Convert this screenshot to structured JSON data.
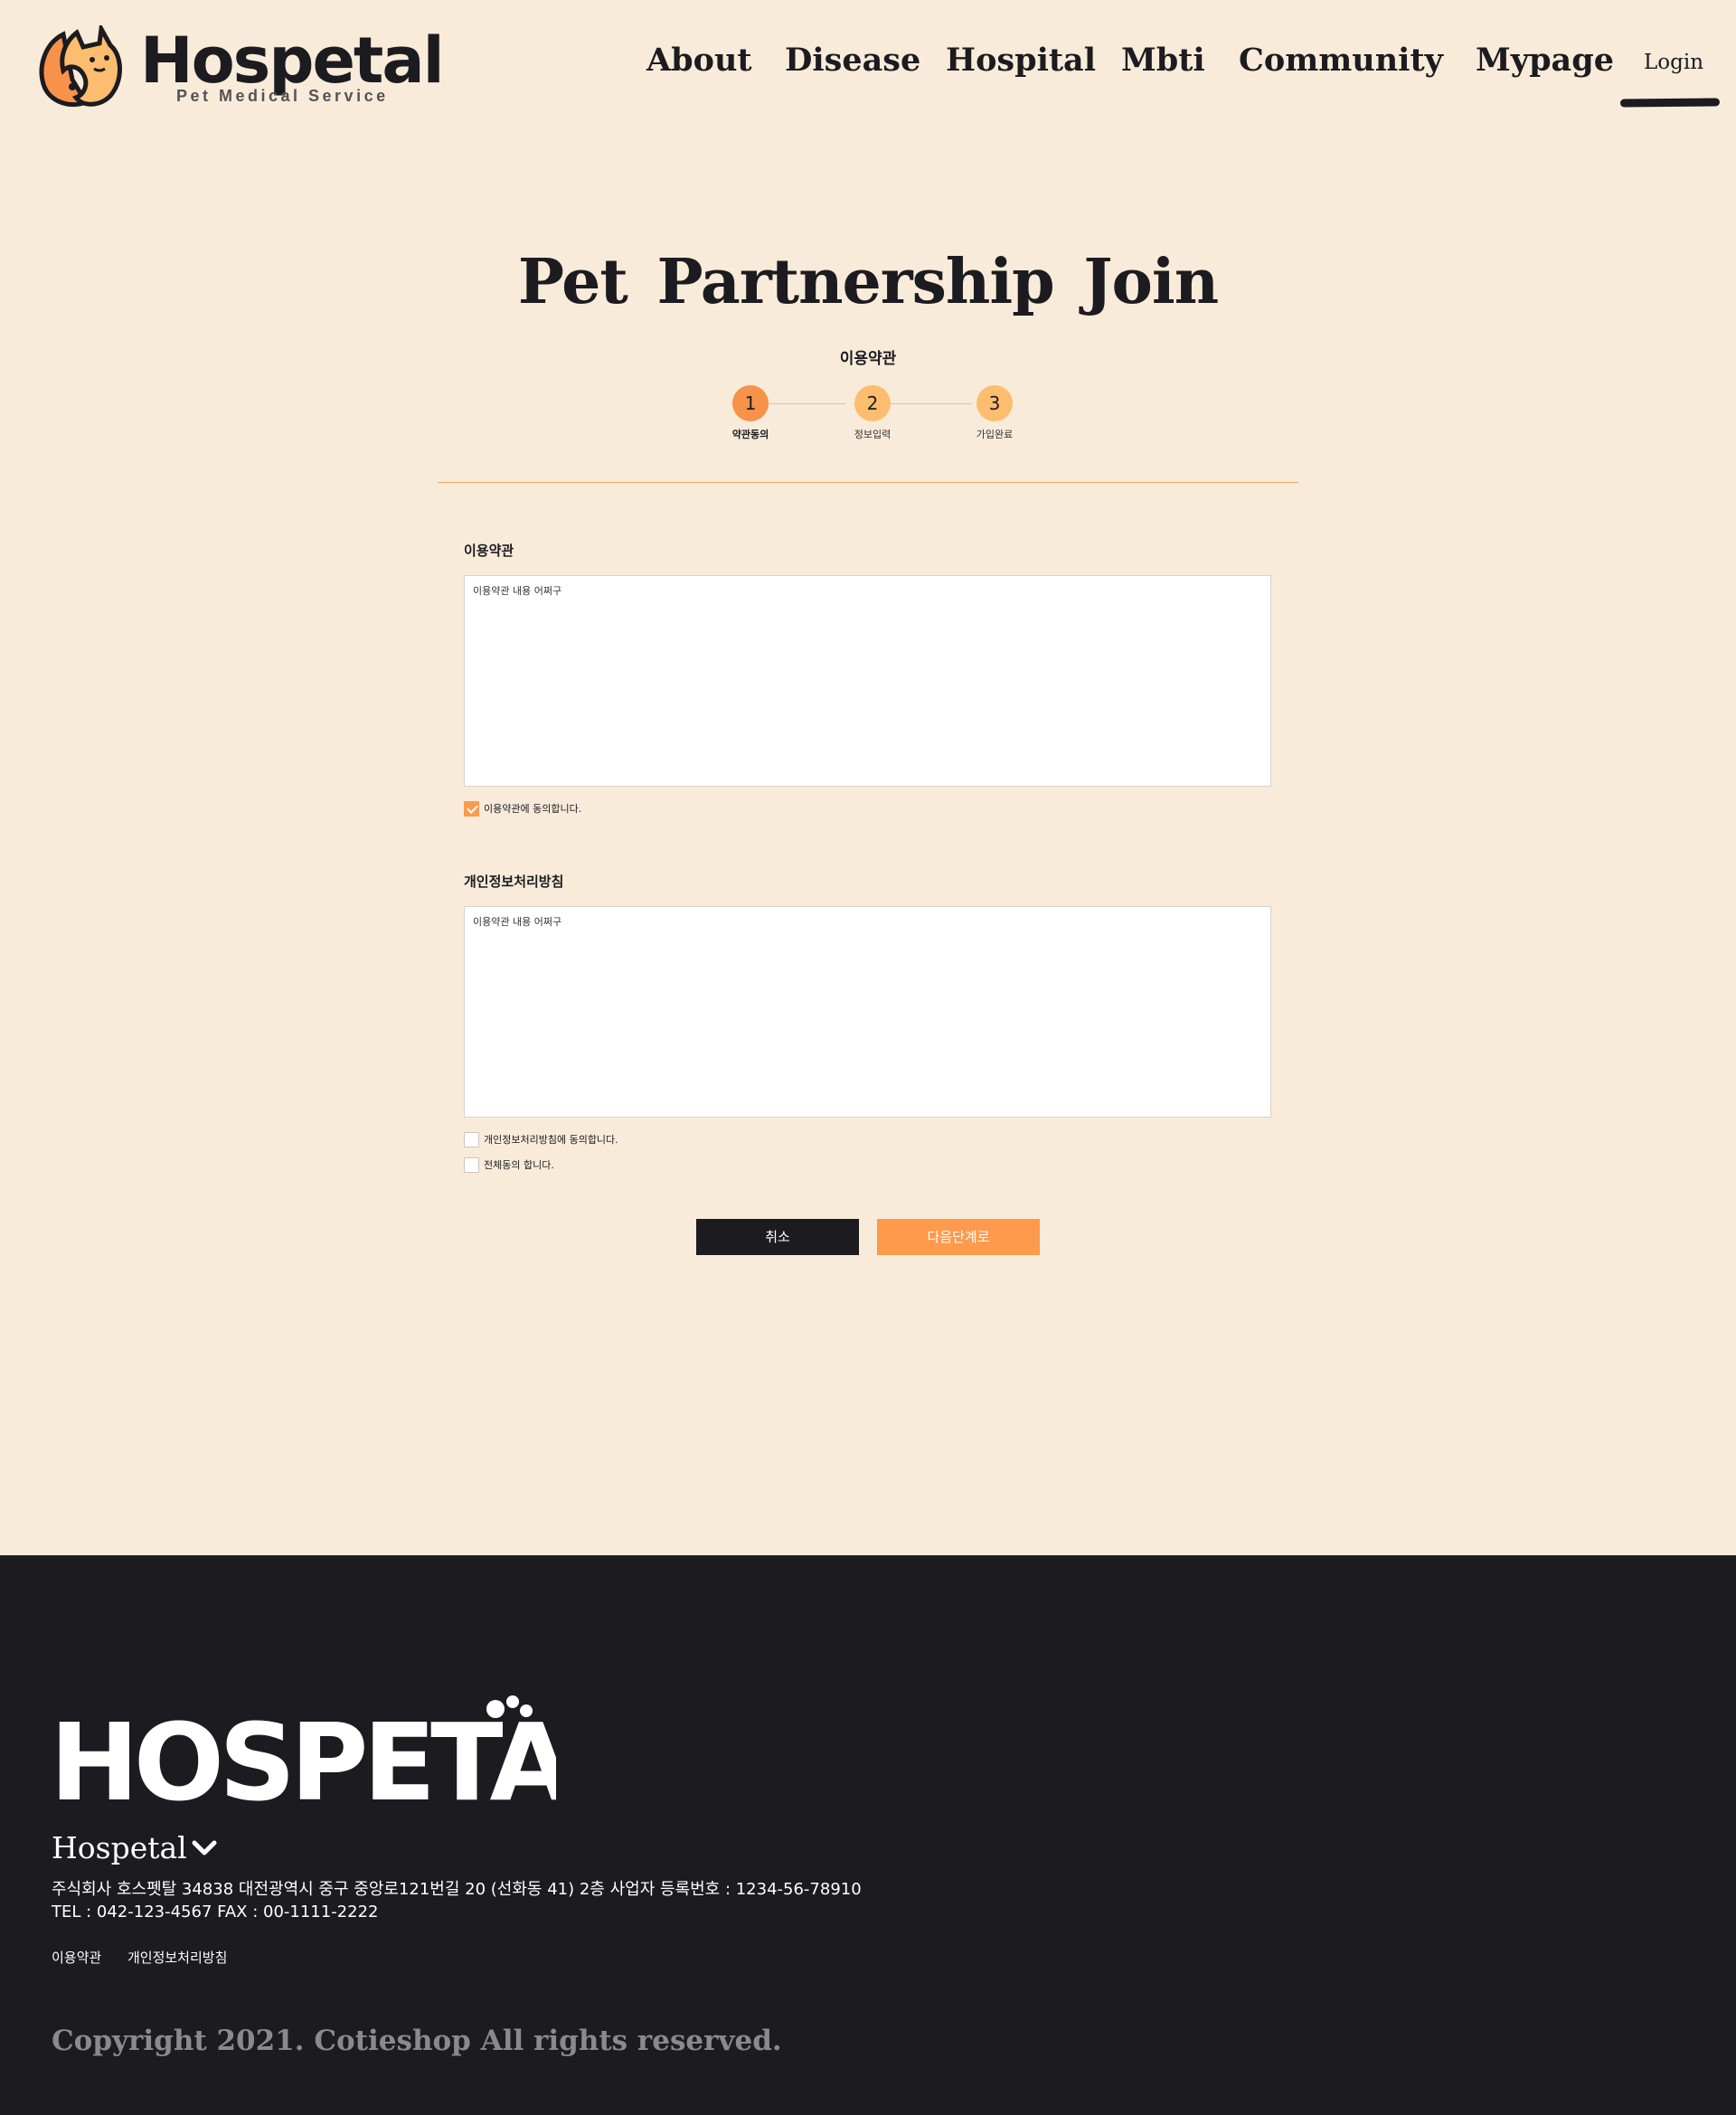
{
  "header": {
    "logo_word": "Hospetal",
    "logo_sub": "Pet Medical Service",
    "nav": [
      {
        "label": "About"
      },
      {
        "label": "Disease"
      },
      {
        "label": "Hospital"
      },
      {
        "label": "Mbti"
      },
      {
        "label": "Community"
      },
      {
        "label": "Mypage"
      }
    ],
    "login_label": "Login"
  },
  "main": {
    "title": "Pet Partnership  Join",
    "current_step_title": "이용약관",
    "steps": [
      {
        "number": "1",
        "label": "약관동의",
        "active": true
      },
      {
        "number": "2",
        "label": "정보입력",
        "active": false
      },
      {
        "number": "3",
        "label": "가입완료",
        "active": false
      }
    ],
    "terms": {
      "label": "이용약관",
      "content": "이용약관 내용 어쩌구",
      "agree_label": "이용약관에 동의합니다.",
      "agree_checked": true
    },
    "privacy": {
      "label": "개인정보처리방침",
      "content": "이용약관 내용 어쩌구",
      "agree_label": "개인정보처리방침에 동의합니다.",
      "agree_checked": false
    },
    "agree_all_label": "전체동의 합니다.",
    "agree_all_checked": false,
    "cancel_label": "취소",
    "next_label": "다음단계로"
  },
  "footer": {
    "logo_word": "HOSPETAL",
    "brand": "Hospetal",
    "address": "주식회사 호스펫탈 34838 대전광역시 중구 중앙로121번길 20 (선화동 41) 2층  사업자 등록번호 : 1234-56-78910",
    "contact": "TEL : 042-123-4567 FAX : 00-1111-2222",
    "links": [
      "이용약관",
      "개인정보처리방침"
    ],
    "copyright": "Copyright 2021. Cotieshop All rights reserved."
  },
  "colors": {
    "background": "#f8ebd9",
    "accent": "#fe9a4c",
    "dark": "#1c1b20",
    "step_active": "#f7924b",
    "step_inactive": "#fdbd6e"
  }
}
